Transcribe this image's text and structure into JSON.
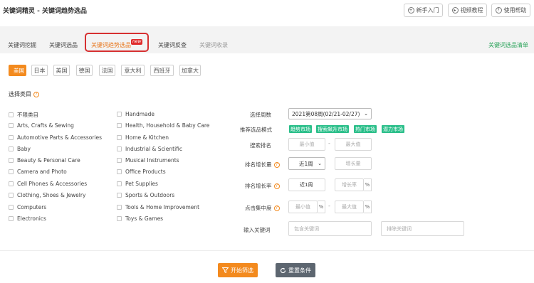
{
  "app": {
    "title": "关键词精灵 - 关键词趋势选品"
  },
  "top_buttons": [
    {
      "label": "新手入门",
      "icon": "plus-circle-icon"
    },
    {
      "label": "视频教程",
      "icon": "play-circle-icon"
    },
    {
      "label": "使用帮助",
      "icon": "help-circle-icon"
    }
  ],
  "tabs": [
    {
      "label": "关键词挖掘",
      "state": "normal"
    },
    {
      "label": "关键词选品",
      "state": "normal"
    },
    {
      "label": "关键词趋势选品",
      "state": "active",
      "badge": "new"
    },
    {
      "label": "关键词反查",
      "state": "normal"
    },
    {
      "label": "关键词收录",
      "state": "muted"
    }
  ],
  "right_link": "关键词选品清单",
  "countries": [
    "美国",
    "日本",
    "英国",
    "德国",
    "法国",
    "意大利",
    "西班牙",
    "加拿大"
  ],
  "selected_country": "美国",
  "category_heading": "选择类目",
  "categories_col1": [
    "不限类目",
    "Arts, Crafts & Sewing",
    "Automotive Parts & Accessories",
    "Baby",
    "Beauty & Personal Care",
    "Camera and Photo",
    "Cell Phones & Accessories",
    "Clothing, Shoes & Jewelry",
    "Computers",
    "Electronics"
  ],
  "categories_col2": [
    "Handmade",
    "Health, Household & Baby Care",
    "Home & Kitchen",
    "Industrial & Scientific",
    "Musical Instruments",
    "Office Products",
    "Pet Supplies",
    "Sports & Outdoors",
    "Tools & Home Improvement",
    "Toys & Games"
  ],
  "form": {
    "week_label": "选择周数",
    "week_value": "2021第08周(02/21-02/27)",
    "mode_label": "推荐选品模式",
    "modes": [
      "趋势市场",
      "搜索飙升市场",
      "热门市场",
      "潜力市场"
    ],
    "rank_label": "搜索排名",
    "min_placeholder": "最小值",
    "max_placeholder": "最大值",
    "growth_label": "排名增长量",
    "growth_period": "近1周",
    "growth_placeholder": "增长量",
    "rate_label": "排名增长率",
    "rate_period": "近1周",
    "rate_placeholder": "增长率",
    "percent": "%",
    "click_label": "点击集中度",
    "keyword_label": "输入关键词",
    "include_placeholder": "包含关键词",
    "exclude_placeholder": "排除关键词"
  },
  "actions": {
    "start": "开始筛选",
    "reset": "重置条件"
  },
  "colors": {
    "accent": "#f38a1e",
    "green_tag": "#2bbf8a",
    "highlight_border": "#d63031",
    "reset": "#5d6670"
  }
}
